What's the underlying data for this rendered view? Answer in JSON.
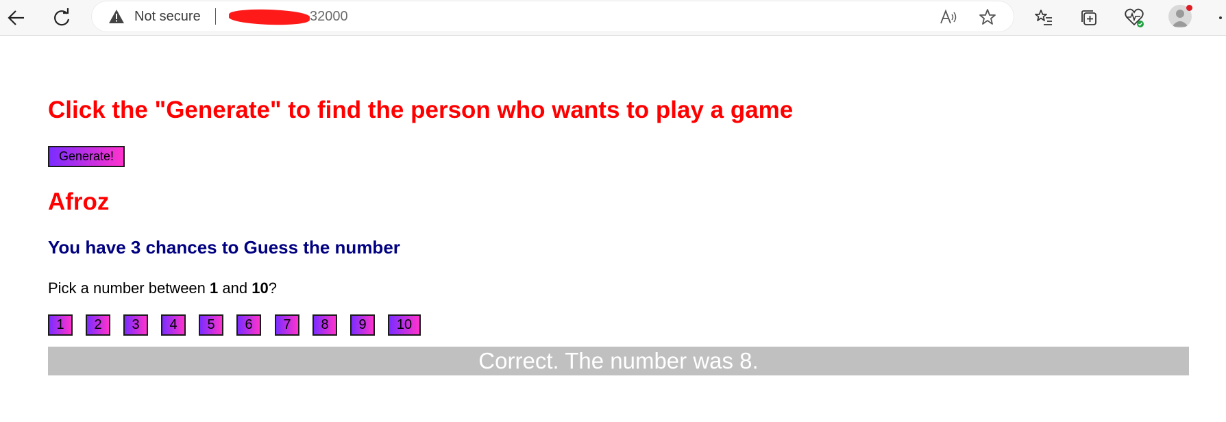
{
  "browser": {
    "security_label": "Not secure",
    "url_visible": "32000",
    "icons": [
      "back-arrow-icon",
      "refresh-icon",
      "warning-icon",
      "read-aloud-icon",
      "favorite-star-icon",
      "favorites-list-icon",
      "collections-icon",
      "browser-health-icon",
      "profile-icon",
      "more-icon"
    ]
  },
  "page": {
    "title": "Click the \"Generate\" to find the person who wants to play a game",
    "generate_label": "Generate!",
    "player_name": "Afroz",
    "chances_text": "You have 3 chances to Guess the number",
    "pick_prefix": "Pick a number between ",
    "pick_min": "1",
    "pick_and": " and ",
    "pick_max": "10",
    "pick_suffix": "?",
    "numbers": [
      "1",
      "2",
      "3",
      "4",
      "5",
      "6",
      "7",
      "8",
      "9",
      "10"
    ],
    "result_text": "Correct. The number was 8."
  },
  "colors": {
    "title_red": "#ff0000",
    "chances_navy": "#000080",
    "button_gradient_start": "#7b2cff",
    "button_gradient_end": "#ff33cc",
    "result_bg": "#c0c0c0"
  }
}
